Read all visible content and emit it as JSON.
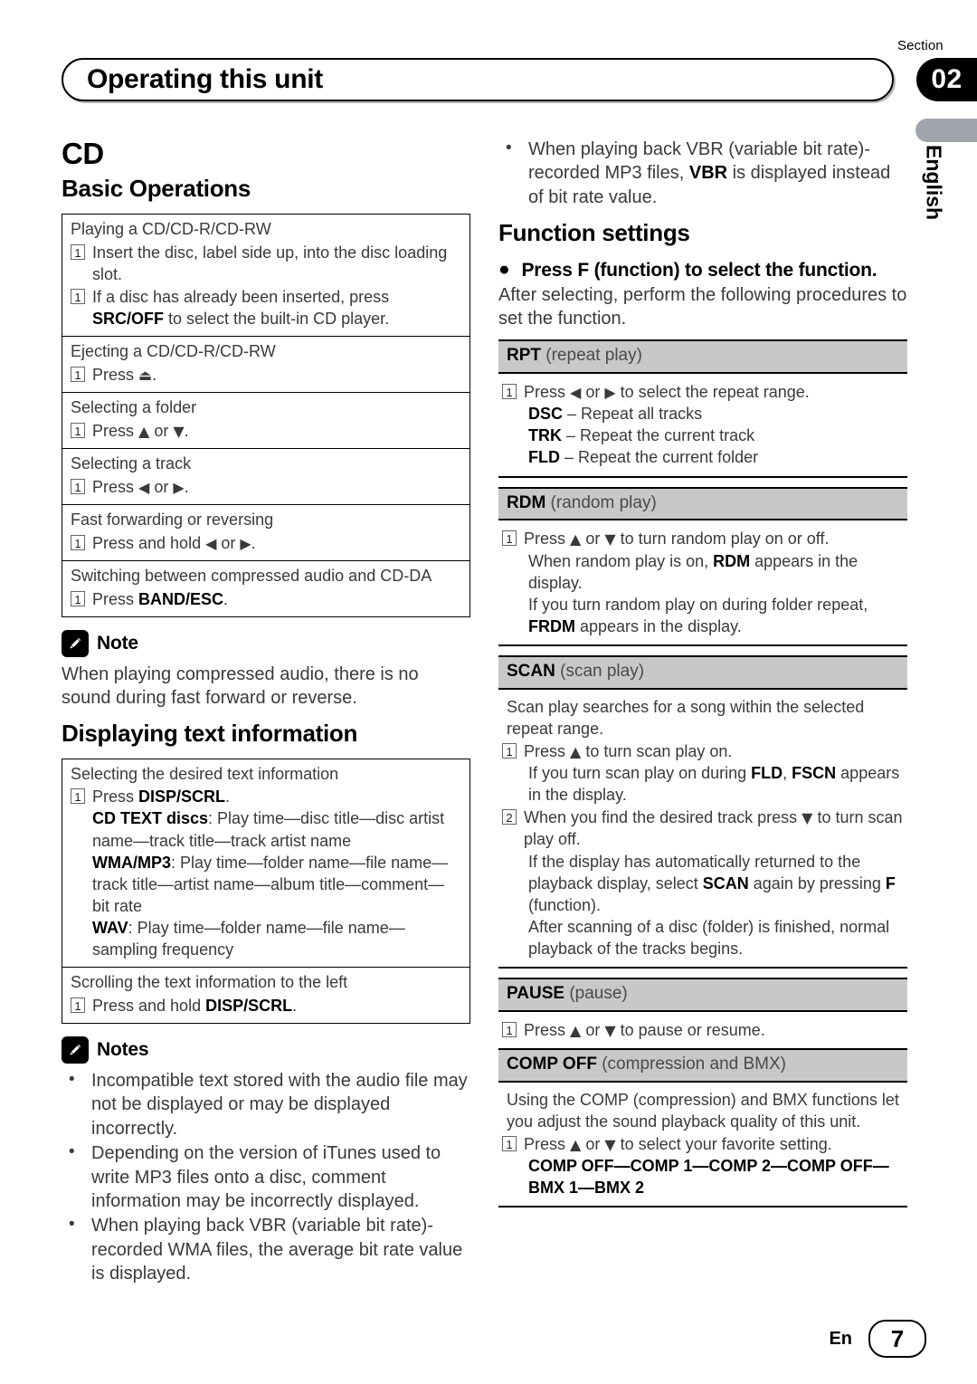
{
  "header": {
    "section_word": "Section",
    "section_number": "02",
    "title": "Operating this unit"
  },
  "side": {
    "language": "English"
  },
  "left": {
    "heading_cd": "CD",
    "heading_basic": "Basic Operations",
    "basic_rows": [
      {
        "title": "Playing a CD/CD-R/CD-RW",
        "steps": [
          {
            "num": "1",
            "html": "Insert the disc, label side up, into the disc loading slot."
          },
          {
            "num": "1",
            "html": "If a disc has already been inserted, press <b>SRC/OFF</b> to select the built-in CD player."
          }
        ]
      },
      {
        "title": "Ejecting a CD/CD-R/CD-RW",
        "steps": [
          {
            "num": "1",
            "html": "Press <span class=\"arrow\">⏏</span>."
          }
        ]
      },
      {
        "title": "Selecting a folder",
        "steps": [
          {
            "num": "1",
            "html": "Press <span class=\"arrow\">▲</span> or <span class=\"arrow\">▼</span>."
          }
        ]
      },
      {
        "title": "Selecting a track",
        "steps": [
          {
            "num": "1",
            "html": "Press <span class=\"arrow\">◀</span> or <span class=\"arrow\">▶</span>."
          }
        ]
      },
      {
        "title": "Fast forwarding or reversing",
        "steps": [
          {
            "num": "1",
            "html": "Press and hold <span class=\"arrow\">◀</span> or <span class=\"arrow\">▶</span>."
          }
        ]
      },
      {
        "title": "Switching between compressed audio and CD-DA",
        "steps": [
          {
            "num": "1",
            "html": "Press <b>BAND/ESC</b>."
          }
        ]
      }
    ],
    "note_label": "Note",
    "note_text": "When playing compressed audio, there is no sound during fast forward or reverse.",
    "heading_display": "Displaying text information",
    "display_rows": [
      {
        "title": "Selecting the desired text information",
        "steps": [
          {
            "num": "1",
            "html": "Press <b>DISP/SCRL</b>."
          }
        ],
        "sub_lines": [
          "<b>CD TEXT discs</b>: Play time—disc title—disc artist name—track title—track artist name",
          "<b>WMA/MP3</b>: Play time—folder name—file name—track title—artist name—album title—comment—bit rate",
          "<b>WAV</b>: Play time—folder name—file name—sampling frequency"
        ]
      },
      {
        "title": "Scrolling the text information to the left",
        "steps": [
          {
            "num": "1",
            "html": "Press and hold <b>DISP/SCRL</b>."
          }
        ],
        "sub_lines": []
      }
    ],
    "notes_label": "Notes",
    "notes_items": [
      "Incompatible text stored with the audio file may not be displayed or may be displayed incorrectly.",
      "Depending on the version of iTunes used to write MP3 files onto a disc, comment information may be incorrectly displayed.",
      "When playing back VBR (variable bit rate)-recorded WMA files, the average bit rate value is displayed."
    ]
  },
  "right": {
    "top_bullets": [
      "When playing back VBR (variable bit rate)-recorded MP3 files, <b>VBR</b> is displayed instead of bit rate value."
    ],
    "heading_function": "Function settings",
    "function_bullet": "Press F (function) to select the function.",
    "function_after": "After selecting, perform the following procedures to set the function.",
    "blocks": [
      {
        "code": "RPT",
        "desc": "(repeat play)",
        "paras": [],
        "steps": [
          {
            "num": "1",
            "html": "Press <span class=\"arrow\">◀</span> or <span class=\"arrow\">▶</span> to select the repeat range."
          }
        ],
        "sub_lines": [
          "<b>DSC</b> – Repeat all tracks",
          "<b>TRK</b> – Repeat the current track",
          "<b>FLD</b> – Repeat the current folder"
        ]
      },
      {
        "code": "RDM",
        "desc": "(random play)",
        "paras": [],
        "steps": [
          {
            "num": "1",
            "html": "Press <span class=\"arrow\">▲</span> or <span class=\"arrow\">▼</span> to turn random play on or off."
          }
        ],
        "sub_lines": [
          "When random play is on, <b>RDM</b> appears in the display.",
          "If you turn random play on during folder repeat, <b>FRDM</b> appears in the display."
        ]
      },
      {
        "code": "SCAN",
        "desc": "(scan play)",
        "paras": [
          "Scan play searches for a song within the selected repeat range."
        ],
        "steps": [
          {
            "num": "1",
            "html": "Press <span class=\"arrow\">▲</span> to turn scan play on.",
            "after": [
              "If you turn scan play on during <b>FLD</b>, <b>FSCN</b> appears in the display."
            ]
          },
          {
            "num": "2",
            "html": "When you find the desired track press <span class=\"arrow\">▼</span> to turn scan play off.",
            "after": [
              "If the display has automatically returned to the playback display, select <b>SCAN</b> again by pressing <b>F</b> (function).",
              "After scanning of a disc (folder) is finished, normal playback of the tracks begins."
            ]
          }
        ],
        "sub_lines": []
      },
      {
        "code": "PAUSE",
        "desc": "(pause)",
        "paras": [],
        "steps": [
          {
            "num": "1",
            "html": "Press <span class=\"arrow\">▲</span> or <span class=\"arrow\">▼</span> to pause or resume."
          }
        ],
        "sub_lines": []
      },
      {
        "code": "COMP OFF",
        "desc": "(compression and BMX)",
        "paras": [
          "Using the COMP (compression) and BMX functions let you adjust the sound playback quality of this unit."
        ],
        "steps": [
          {
            "num": "1",
            "html": "Press <span class=\"arrow\">▲</span> or <span class=\"arrow\">▼</span> to select your favorite setting."
          }
        ],
        "sub_lines": [
          "<b>COMP OFF—COMP 1—COMP 2—COMP OFF—BMX 1—BMX 2</b>"
        ]
      }
    ]
  },
  "footer": {
    "lang_code": "En",
    "page_number": "7"
  }
}
